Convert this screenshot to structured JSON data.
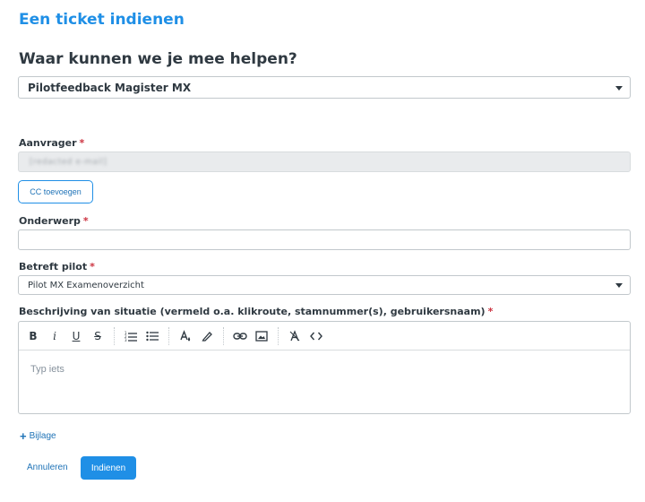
{
  "page": {
    "title": "Een ticket indienen",
    "subtitle": "Waar kunnen we je mee helpen?"
  },
  "form_select": {
    "value": "Pilotfeedback Magister MX"
  },
  "fields": {
    "requester": {
      "label": "Aanvrager",
      "required": "*",
      "value": "[redacted e-mail]"
    },
    "cc_button": "CC toevoegen",
    "subject": {
      "label": "Onderwerp",
      "required": "*",
      "value": ""
    },
    "pilot": {
      "label": "Betreft pilot",
      "required": "*",
      "value": "Pilot MX Examenoverzicht"
    },
    "description": {
      "label": "Beschrijving van situatie (vermeld o.a. klikroute, stamnummer(s), gebruikersnaam)",
      "required": "*",
      "placeholder": "Typ iets"
    }
  },
  "toolbar": {
    "bold": "B",
    "italic": "i",
    "underline": "U",
    "strikethrough": "S",
    "icons": [
      "bold-icon",
      "italic-icon",
      "underline-icon",
      "strikethrough-icon",
      "numbered-list-icon",
      "bullet-list-icon",
      "text-color-icon",
      "highlight-icon",
      "link-icon",
      "image-icon",
      "clear-format-icon",
      "code-icon"
    ]
  },
  "attachment": {
    "label": "Bijlage",
    "icon": "plus-icon"
  },
  "actions": {
    "cancel": "Annuleren",
    "submit": "Indienen"
  },
  "colors": {
    "accent": "#1f8fe6",
    "link": "#1f73b7",
    "required": "#cc3340",
    "text": "#2f3941"
  }
}
